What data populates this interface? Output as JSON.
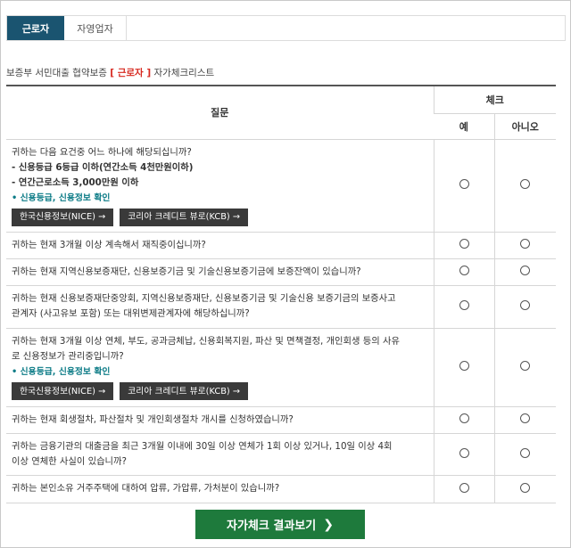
{
  "tabs": [
    {
      "label": "근로자",
      "active": true
    },
    {
      "label": "자영업자",
      "active": false
    }
  ],
  "subtitle": {
    "prefix": "보증부 서민대출 협약보증",
    "highlight": "[ 근로자 ]",
    "suffix": "자가체크리스트"
  },
  "table": {
    "question_header": "질문",
    "check_header": "체크",
    "yes_label": "예",
    "no_label": "아니오",
    "rows": [
      {
        "lines": [
          "귀하는 다음 요건중 어느 하나에 해당되십니까?"
        ],
        "bold_lines": [
          "- 신용등급 6등급 이하(연간소득 4천만원이하)",
          "- 연간근로소득 3,000만원 이하"
        ],
        "note": "• 신용등급, 신용정보 확인",
        "buttons": [
          "한국신용정보(NICE) →",
          "코리아 크레디트 뷰로(KCB) →"
        ]
      },
      {
        "lines": [
          "귀하는 현재 3개월 이상 계속해서 재직중이십니까?"
        ]
      },
      {
        "lines": [
          "귀하는 현재 지역신용보증재단, 신용보증기금 및 기술신용보증기금에 보증잔액이 있습니까?"
        ]
      },
      {
        "lines": [
          "귀하는 현재 신용보증재단중앙회, 지역신용보증재단, 신용보증기금 및 기술신용 보증기금의 보증사고",
          "관계자 (사고유보 포함) 또는 대위변제관계자에 해당하십니까?"
        ]
      },
      {
        "lines": [
          "귀하는 현재 3개월 이상 연체, 부도, 공과금체납, 신용회복지원, 파산 및 면책결정, 개인회생 등의 사유",
          "로 신용정보가 관리중입니까?"
        ],
        "note": "• 신용등급, 신용정보 확인",
        "buttons": [
          "한국신용정보(NICE) →",
          "코리아 크레디트 뷰로(KCB) →"
        ]
      },
      {
        "lines": [
          "귀하는 현재 회생절차, 파산절차 및 개인회생절차 개시를 신청하였습니까?"
        ]
      },
      {
        "lines": [
          "귀하는 금융기관의 대출금을 최근 3개월 이내에 30일 이상 연체가 1회 이상 있거나, 10일 이상 4회",
          "이상 연체한 사실이 있습니까?"
        ]
      },
      {
        "lines": [
          "귀하는 본인소유 거주주택에 대하여 압류, 가압류, 가처분이 있습니까?"
        ]
      }
    ]
  },
  "cta": {
    "label": "자가체크 결과보기",
    "chevron": "❯"
  }
}
